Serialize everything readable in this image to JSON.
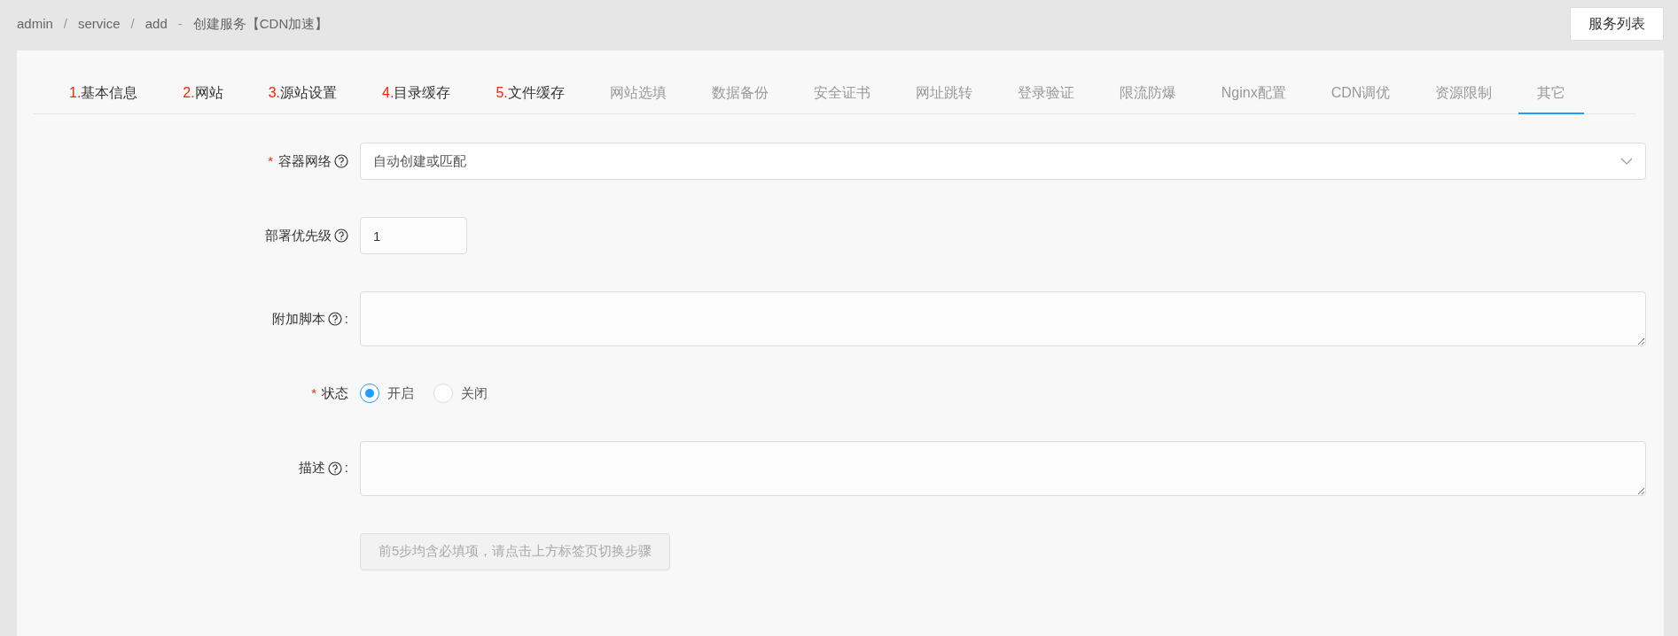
{
  "breadcrumb": [
    {
      "text": "admin",
      "kind": "link"
    },
    {
      "text": "/",
      "kind": "separator"
    },
    {
      "text": "service",
      "kind": "link"
    },
    {
      "text": "/",
      "kind": "separator"
    },
    {
      "text": "add",
      "kind": "link"
    },
    {
      "text": "-",
      "kind": "separator"
    },
    {
      "text": "创建服务【CDN加速】",
      "kind": "title"
    }
  ],
  "header_button": "服务列表",
  "tabs": [
    {
      "number": "1.",
      "label": "基本信息",
      "kind": "step",
      "selected": false
    },
    {
      "number": "2.",
      "label": "网站",
      "kind": "step",
      "selected": false
    },
    {
      "number": "3.",
      "label": "源站设置",
      "kind": "step",
      "selected": false
    },
    {
      "number": "4.",
      "label": "目录缓存",
      "kind": "step",
      "selected": false
    },
    {
      "number": "5.",
      "label": "文件缓存",
      "kind": "step",
      "selected": false
    },
    {
      "label": "网站选填",
      "kind": "optional",
      "selected": false
    },
    {
      "label": "数据备份",
      "kind": "optional",
      "selected": false
    },
    {
      "label": "安全证书",
      "kind": "optional",
      "selected": false
    },
    {
      "label": "网址跳转",
      "kind": "optional",
      "selected": false
    },
    {
      "label": "登录验证",
      "kind": "optional",
      "selected": false
    },
    {
      "label": "限流防爆",
      "kind": "optional",
      "selected": false
    },
    {
      "label": "Nginx配置",
      "kind": "optional",
      "selected": false
    },
    {
      "label": "CDN调优",
      "kind": "optional",
      "selected": false
    },
    {
      "label": "资源限制",
      "kind": "optional",
      "selected": false
    },
    {
      "label": "其它",
      "kind": "optional",
      "selected": true
    }
  ],
  "fields": [
    {
      "required_mark": "*",
      "label": "容器网络",
      "kind": "select",
      "value": "自动创建或匹配"
    },
    {
      "label": "部署优先级",
      "kind": "number",
      "value": "1"
    },
    {
      "label": "附加脚本",
      "colon": ":",
      "kind": "textarea"
    },
    {
      "required_mark": "*",
      "label": "状态",
      "kind": "radio",
      "options": [
        {
          "label": "开启",
          "selected": true
        },
        {
          "label": "关闭",
          "selected": false
        }
      ]
    },
    {
      "label": "描述",
      "colon": ":",
      "kind": "textarea"
    }
  ],
  "submit": {
    "label": "前5步均含必填项，请点击上方标签页切换步骤",
    "disabled": true
  }
}
